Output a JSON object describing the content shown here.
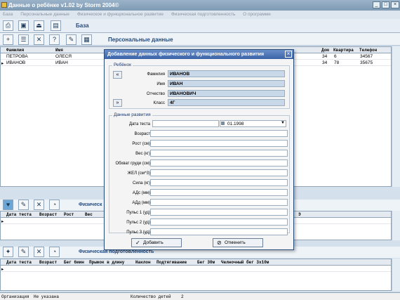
{
  "window": {
    "title": "Данные о ребёнке v1.02 by Storm 2004©"
  },
  "menu": [
    "База",
    "Персональные данные",
    "Физическое и функциональное развитие",
    "Физическая подготовленность",
    "О программе"
  ],
  "toolbar": {
    "title": "База"
  },
  "personal": {
    "title": "Персональные данные",
    "columns": [
      "Фамилия",
      "Имя",
      "Дом",
      "Квартира",
      "Телефон"
    ],
    "rows": [
      [
        "ПЕТРОВА",
        "ОЛЕСЯ",
        "34",
        "6",
        "34567"
      ],
      [
        "ИВАНОВ",
        "ИВАН",
        "34",
        "78",
        "35675"
      ]
    ]
  },
  "physical": {
    "title": "Физическ",
    "columns": [
      "Дата теста",
      "Возраст",
      "Рост",
      "Вес",
      "Э"
    ]
  },
  "fitness": {
    "title": "Физическая подготовленность",
    "columns": [
      "Дата теста",
      "Возраст",
      "Бег 6мин",
      "Прыжок в длину",
      "Наклон",
      "Подтягивание",
      "Бег 30м",
      "Челночный бег 3х10м"
    ]
  },
  "dialog": {
    "title": "Добавление данных физического и функционального развития",
    "child_group": "Ребёнок",
    "child": [
      {
        "label": "Фамилия",
        "value": "ИВАНОВ"
      },
      {
        "label": "Имя",
        "value": "ИВАН"
      },
      {
        "label": "Отчество",
        "value": "ИВАНОВИЧ"
      },
      {
        "label": "Класс",
        "value": "4Г"
      }
    ],
    "dev_group": "Данные развития",
    "date_label": "Дата теста",
    "date_value": "01.1998",
    "fields": [
      "Возраст",
      "Рост (см)",
      "Вес (кг)",
      "Обхват груди (см)",
      "ЖЕЛ (см^3)",
      "Сила (кг)",
      "АДс (мм)",
      "АДд (мм)",
      "Пульс 1 (уд)",
      "Пульс 2 (уд)",
      "Пульс 3 (уд)"
    ],
    "add_label": "Добавить",
    "cancel_label": "Отменить"
  },
  "status": {
    "org_label": "Организация",
    "org_value": "Не указана",
    "count_label": "Количество детей",
    "count_value": "2"
  }
}
